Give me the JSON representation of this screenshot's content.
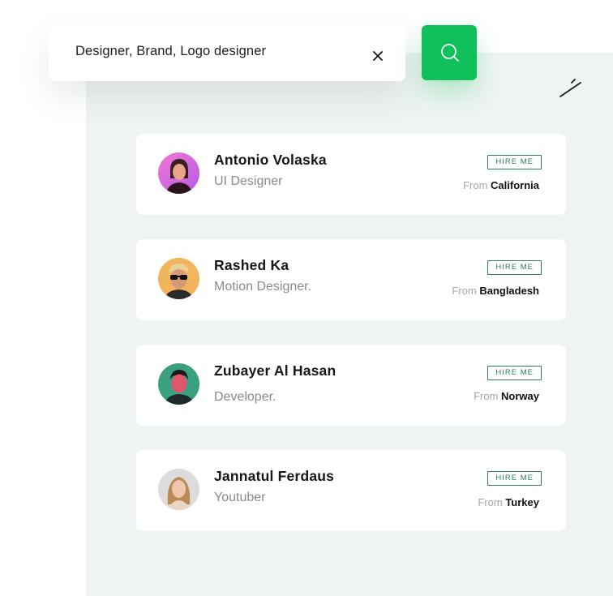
{
  "search": {
    "query": "Designer, Brand, Logo designer",
    "clear_icon": "close-icon",
    "button_icon": "search-icon"
  },
  "toolbar": {
    "edit_icon": "pencil-icon"
  },
  "colors": {
    "accent": "#0fc05b",
    "panel_bg": "#eef4f1",
    "badge": "#2c7d58"
  },
  "people": [
    {
      "name": "Antonio Volaska",
      "role": "UI Designer",
      "hire_label": "HIRE ME",
      "from_label": "From",
      "location": "California"
    },
    {
      "name": "Rashed Ka",
      "role": "Motion Designer.",
      "hire_label": "HIRE ME",
      "from_label": "From",
      "location": "Bangladesh"
    },
    {
      "name": "Zubayer Al Hasan",
      "role": "Developer.",
      "hire_label": "HIRE ME",
      "from_label": "From",
      "location": "Norway"
    },
    {
      "name": "Jannatul Ferdaus",
      "role": "Youtuber",
      "hire_label": "HIRE ME",
      "from_label": "From",
      "location": "Turkey"
    }
  ]
}
